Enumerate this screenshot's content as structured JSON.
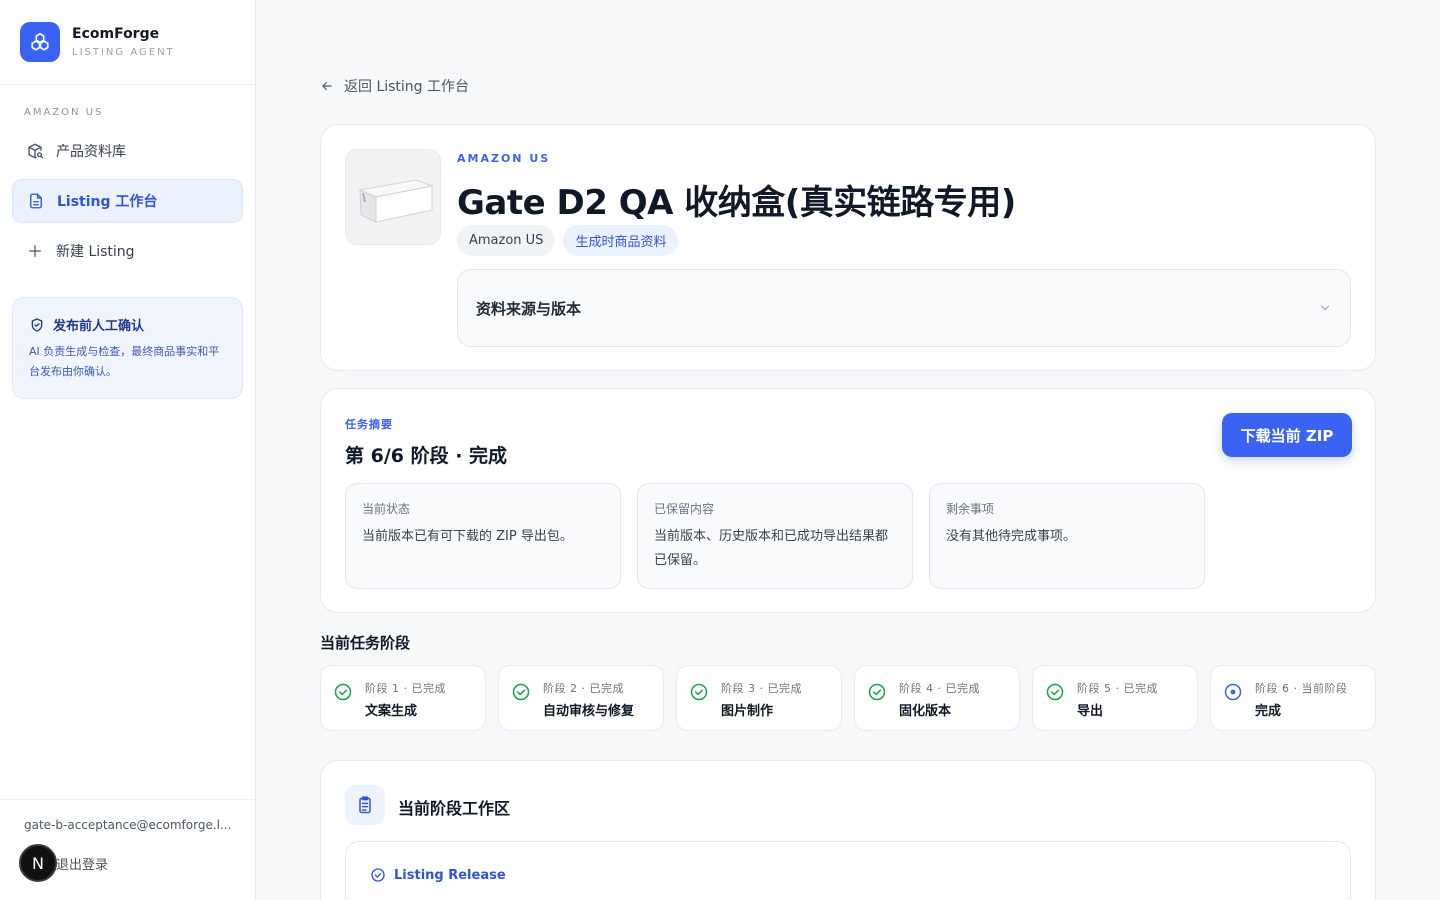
{
  "brand": {
    "name": "EcomForge",
    "subtitle": "LISTING AGENT"
  },
  "sidebar": {
    "section_label": "AMAZON US",
    "items": [
      {
        "label": "产品资料库",
        "icon": "package-search-icon",
        "active": false
      },
      {
        "label": "Listing 工作台",
        "icon": "document-icon",
        "active": true
      },
      {
        "label": "新建 Listing",
        "icon": "plus-icon",
        "active": false
      }
    ],
    "confirm_card": {
      "title": "发布前人工确认",
      "text": "AI 负责生成与检查，最终商品事实和平台发布由你确认。"
    },
    "user": {
      "email": "gate-b-acceptance@ecomforge.l...",
      "logout_label": "退出登录",
      "avatar_letter": "N"
    }
  },
  "main": {
    "back_label": "返回 Listing 工作台",
    "product": {
      "eyebrow": "AMAZON US",
      "title": "Gate D2 QA 收纳盒(真实链路专用)",
      "chips": [
        "Amazon US",
        "生成时商品资料"
      ],
      "accordion_title": "资料来源与版本"
    },
    "summary": {
      "eyebrow": "任务摘要",
      "title": "第 6/6 阶段 · 完成",
      "download_label": "下载当前 ZIP",
      "boxes": [
        {
          "label": "当前状态",
          "text": "当前版本已有可下载的 ZIP 导出包。"
        },
        {
          "label": "已保留内容",
          "text": "当前版本、历史版本和已成功导出结果都已保留。"
        },
        {
          "label": "剩余事项",
          "text": "没有其他待完成事项。"
        }
      ]
    },
    "stages_heading": "当前任务阶段",
    "stages": [
      {
        "meta": "阶段 1 · 已完成",
        "name": "文案生成",
        "status": "done"
      },
      {
        "meta": "阶段 2 · 已完成",
        "name": "自动审核与修复",
        "status": "done"
      },
      {
        "meta": "阶段 3 · 已完成",
        "name": "图片制作",
        "status": "done"
      },
      {
        "meta": "阶段 4 · 已完成",
        "name": "固化版本",
        "status": "done"
      },
      {
        "meta": "阶段 5 · 已完成",
        "name": "导出",
        "status": "done"
      },
      {
        "meta": "阶段 6 · 当前阶段",
        "name": "完成",
        "status": "current"
      }
    ],
    "workspace": {
      "title": "当前阶段工作区",
      "release_label": "Listing Release"
    }
  },
  "colors": {
    "accent": "#3b63f3",
    "success": "#16a34a",
    "sidebar_active_bg": "#eaf1ff"
  }
}
